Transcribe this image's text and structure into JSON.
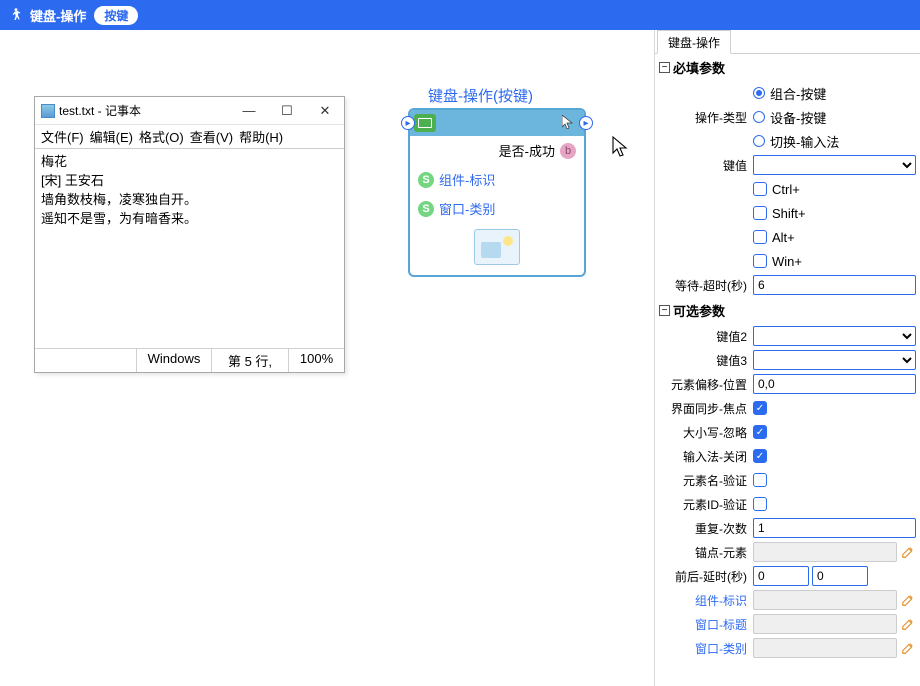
{
  "header": {
    "title": "键盘-操作",
    "pill": "按键"
  },
  "notepad": {
    "title": "test.txt - 记事本",
    "menu": {
      "file": "文件(F)",
      "edit": "编辑(E)",
      "format": "格式(O)",
      "view": "查看(V)",
      "help": "帮助(H)"
    },
    "body_line1": "梅花",
    "body_line2": "[宋] 王安石",
    "body_line3": "",
    "body_line4": "墙角数枝梅，凌寒独自开。",
    "body_line5": "遥知不是雪，为有暗香来。",
    "status": {
      "os": "Windows",
      "line": "第 5 行,",
      "zoom": "100%"
    }
  },
  "node": {
    "title": "键盘-操作(按键)",
    "success": "是否-成功",
    "compId": "组件-标识",
    "winClass": "窗口-类别"
  },
  "rightPanel": {
    "tab": "键盘-操作",
    "required": "必填参数",
    "optional": "可选参数",
    "labels": {
      "opType": "操作-类型",
      "keyValue": "键值",
      "ctrl": "Ctrl+",
      "shift": "Shift+",
      "alt": "Alt+",
      "win": "Win+",
      "waitTimeout": "等待-超时(秒)",
      "keyValue2": "键值2",
      "keyValue3": "键值3",
      "offsetPos": "元素偏移-位置",
      "syncFocus": "界面同步-焦点",
      "caseIgnore": "大小写-忽略",
      "imeClose": "输入法-关闭",
      "nameVerify": "元素名-验证",
      "idVerify": "元素ID-验证",
      "repeatCount": "重复-次数",
      "anchorElem": "锚点-元素",
      "delayBA": "前后-延时(秒)",
      "compId": "组件-标识",
      "winTitle": "窗口-标题",
      "winClass": "窗口-类别"
    },
    "radioOptions": {
      "combo": "组合-按键",
      "device": "设备-按键",
      "switchIme": "切换-输入法"
    },
    "values": {
      "waitTimeout": "6",
      "offsetPos": "0,0",
      "repeatCount": "1",
      "delayBefore": "0",
      "delayAfter": "0"
    }
  }
}
